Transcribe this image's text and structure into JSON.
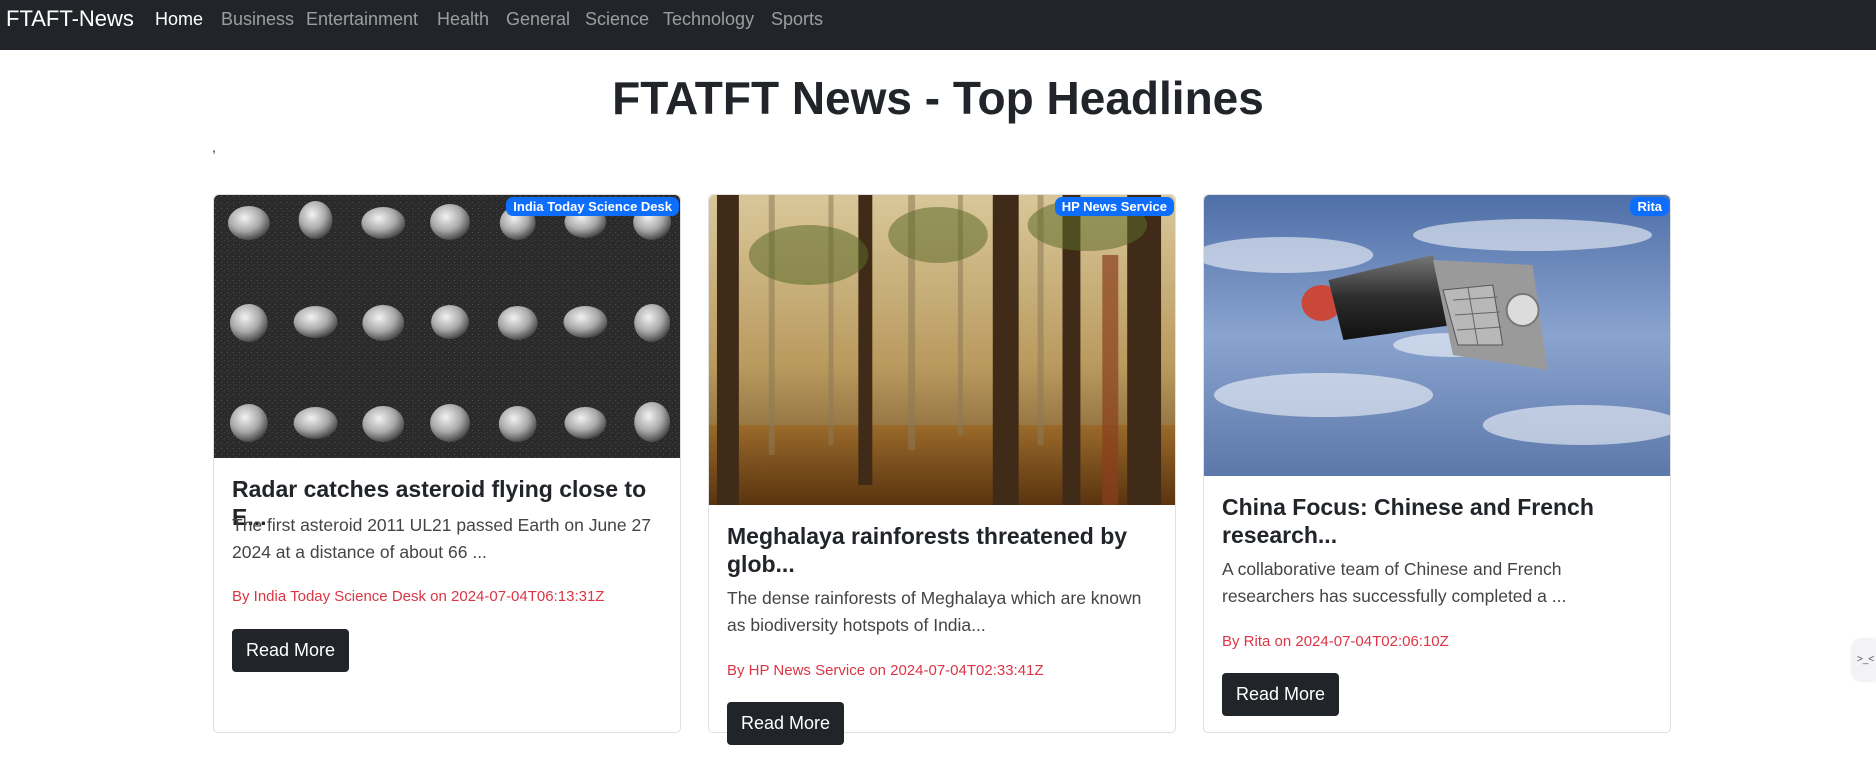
{
  "nav": {
    "brand": "FTAFT-News",
    "items": [
      {
        "label": "Home",
        "active": true
      },
      {
        "label": "Business",
        "active": false
      },
      {
        "label": "Entertainment",
        "active": false
      },
      {
        "label": "Health",
        "active": false
      },
      {
        "label": "General",
        "active": false
      },
      {
        "label": "Science",
        "active": false
      },
      {
        "label": "Technology",
        "active": false
      },
      {
        "label": "Sports",
        "active": false
      }
    ]
  },
  "page": {
    "title": "FTATFT News - Top Headlines",
    "stray_text": ","
  },
  "colors": {
    "navbar": "#212529",
    "badge": "#0d6efd",
    "meta": "#dc3545",
    "button": "#212529"
  },
  "articles": [
    {
      "source": "India Today Science Desk",
      "title": "Radar catches asteroid flying close to E...",
      "description": "The first asteroid 2011 UL21 passed Earth on June 27 2024 at a distance of about 66 ...",
      "meta": "By India Today Science Desk on 2024-07-04T06:13:31Z",
      "button": "Read More",
      "image": "asteroid-radar-image"
    },
    {
      "source": "HP News Service",
      "title": "Meghalaya rainforests threatened by glob...",
      "description": "The dense rainforests of Meghalaya which are known as biodiversity hotspots of India...",
      "meta": "By HP News Service on 2024-07-04T02:33:41Z",
      "button": "Read More",
      "image": "misty-forest-image"
    },
    {
      "source": "Rita",
      "title": "China Focus: Chinese and French research...",
      "description": "A collaborative team of Chinese and French researchers has successfully completed a ...",
      "meta": "By Rita on 2024-07-04T02:06:10Z",
      "button": "Read More",
      "image": "satellite-image"
    }
  ],
  "widget": {
    "label": ">_<"
  }
}
